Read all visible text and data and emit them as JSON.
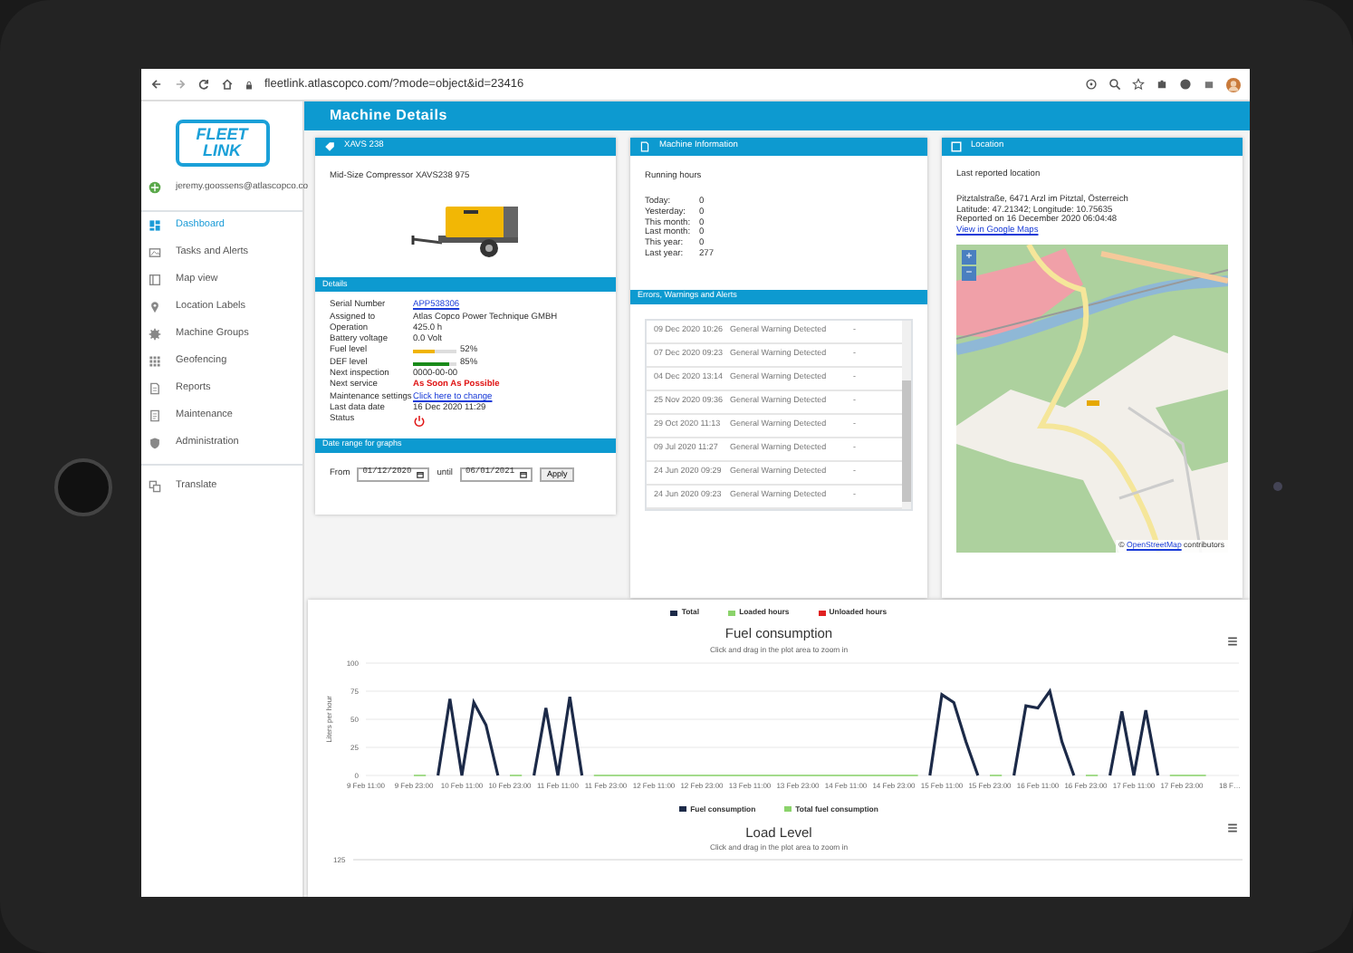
{
  "browser": {
    "url": "fleetlink.atlascopco.com/?mode=object&id=23416"
  },
  "sidebar": {
    "logo": "FLEET LINK",
    "user": "jeremy.goossens@atlascopco.co",
    "items": [
      {
        "label": "Dashboard",
        "selected": true
      },
      {
        "label": "Tasks and Alerts",
        "selected": false
      },
      {
        "label": "Map view",
        "selected": false
      },
      {
        "label": "Location Labels",
        "selected": false
      },
      {
        "label": "Machine Groups",
        "selected": false
      },
      {
        "label": "Geofencing",
        "selected": false
      },
      {
        "label": "Reports",
        "selected": false
      },
      {
        "label": "Maintenance",
        "selected": false
      },
      {
        "label": "Administration",
        "selected": false
      },
      {
        "label": "Translate",
        "selected": false
      }
    ]
  },
  "page_title": "Machine Details",
  "machine_card": {
    "title": "XAVS 238",
    "description": "Mid-Size Compressor XAVS238 975",
    "details_title": "Details",
    "details": [
      {
        "label": "Serial Number",
        "value": "APP538306",
        "kind": "link"
      },
      {
        "label": "Assigned to",
        "value": "Atlas Copco Power Technique GMBH",
        "kind": "text"
      },
      {
        "label": "Operation",
        "value": "425.0 h",
        "kind": "text"
      },
      {
        "label": "Battery voltage",
        "value": "0.0 Volt",
        "kind": "text"
      },
      {
        "label": "Fuel level",
        "value": "52%",
        "kind": "meter",
        "level": 0.52,
        "color": "#f0b400"
      },
      {
        "label": "DEF level",
        "value": "85%",
        "kind": "meter",
        "level": 0.85,
        "color": "#1a8a1a"
      },
      {
        "label": "Next inspection",
        "value": "0000-00-00",
        "kind": "text"
      },
      {
        "label": "Next service",
        "value": "As Soon As Possible",
        "kind": "alert"
      },
      {
        "label": "Maintenance settings",
        "value": "Click here to change",
        "kind": "link"
      },
      {
        "label": "Last data date",
        "value": "16 Dec 2020 11:29",
        "kind": "text"
      },
      {
        "label": "Status",
        "kind": "status"
      }
    ],
    "range_title": "Date range for graphs",
    "from_label": "From",
    "from_value": "01/12/2020",
    "until_label": "until",
    "until_value": "06/01/2021",
    "apply": "Apply"
  },
  "info_card": {
    "title": "Machine Information",
    "running_title": "Running hours",
    "running": [
      {
        "label": "Today:",
        "value": "0"
      },
      {
        "label": "Yesterday:",
        "value": "0"
      },
      {
        "label": "This month:",
        "value": "0"
      },
      {
        "label": "Last month:",
        "value": "0"
      },
      {
        "label": "This year:",
        "value": "0"
      },
      {
        "label": "Last year:",
        "value": "277"
      }
    ],
    "errors_title": "Errors, Warnings and Alerts",
    "errors": [
      {
        "date": "09 Dec 2020 10:26",
        "message": "General Warning Detected",
        "extra": "-"
      },
      {
        "date": "07 Dec 2020 09:23",
        "message": "General Warning Detected",
        "extra": "-"
      },
      {
        "date": "04 Dec 2020 13:14",
        "message": "General Warning Detected",
        "extra": "-"
      },
      {
        "date": "25 Nov 2020 09:36",
        "message": "General Warning Detected",
        "extra": "-"
      },
      {
        "date": "29 Oct 2020 11:13",
        "message": "General Warning Detected",
        "extra": "-"
      },
      {
        "date": "09 Jul 2020 11:27",
        "message": "General Warning Detected",
        "extra": "-"
      },
      {
        "date": "24 Jun 2020 09:29",
        "message": "General Warning Detected",
        "extra": "-"
      },
      {
        "date": "24 Jun 2020 09:23",
        "message": "General Warning Detected",
        "extra": "-"
      }
    ]
  },
  "location_card": {
    "title": "Location",
    "heading": "Last reported location",
    "address": "Pitztalstraße, 6471 Arzl im Pitztal, Österreich",
    "coordinates": "Latitude: 47.21342; Longitude: 10.75635",
    "reported": "Reported on 16 December 2020 06:04:48",
    "maps_link": "View in Google Maps",
    "zoom_in": "+",
    "zoom_out": "−",
    "attribution_prefix": "©",
    "attribution_link": "OpenStreetMap",
    "attribution_suffix": "contributors"
  },
  "fuel_chart": {
    "extra_legend": [
      {
        "name": "Unloaded hours",
        "color": "#e02020"
      }
    ],
    "subtitle": "Click and drag in the plot area to zoom in",
    "chart_data": {
      "type": "line",
      "grid": true,
      "title": "Fuel consumption",
      "ylabel": "Liters per hour",
      "ylim": [
        0,
        100
      ],
      "yticks": [
        0,
        25,
        50,
        75,
        100
      ],
      "categories": [
        "9 Feb 11:00",
        null,
        null,
        null,
        "9 Feb 23:00",
        null,
        null,
        null,
        "10 Feb 11:00",
        null,
        null,
        null,
        "10 Feb 23:00",
        null,
        null,
        null,
        "11 Feb 11:00",
        null,
        null,
        null,
        "11 Feb 23:00",
        null,
        null,
        null,
        "12 Feb 11:00",
        null,
        null,
        null,
        "12 Feb 23:00",
        null,
        null,
        null,
        "13 Feb 11:00",
        null,
        null,
        null,
        "13 Feb 23:00",
        null,
        null,
        null,
        "14 Feb 11:00",
        null,
        null,
        null,
        "14 Feb 23:00",
        null,
        null,
        null,
        "15 Feb 11:00",
        null,
        null,
        null,
        "15 Feb 23:00",
        null,
        null,
        null,
        "16 Feb 11:00",
        null,
        null,
        null,
        "16 Feb 23:00",
        null,
        null,
        null,
        "17 Feb 11:00",
        null,
        null,
        null,
        "17 Feb 23:00",
        null,
        null,
        null,
        "18 F…"
      ],
      "series": [
        {
          "name": "Total",
          "color": "#1c2a48",
          "values": [
            null,
            null,
            null,
            null,
            null,
            null,
            0,
            68,
            0,
            65,
            45,
            0,
            null,
            null,
            0,
            60,
            0,
            70,
            0,
            null,
            null,
            null,
            null,
            null,
            null,
            null,
            null,
            null,
            null,
            null,
            null,
            null,
            null,
            null,
            null,
            null,
            null,
            null,
            null,
            null,
            null,
            null,
            null,
            null,
            null,
            null,
            null,
            0,
            72,
            65,
            30,
            0,
            null,
            null,
            0,
            62,
            60,
            75,
            30,
            0,
            null,
            null,
            0,
            57,
            0,
            58,
            0,
            null,
            null,
            null,
            null,
            null,
            null
          ]
        },
        {
          "name": "Loaded hours",
          "color": "#8bd36b",
          "values": [
            null,
            null,
            null,
            null,
            0,
            0,
            null,
            null,
            null,
            null,
            null,
            null,
            0,
            0,
            null,
            null,
            null,
            null,
            null,
            0,
            0,
            0,
            0,
            0,
            0,
            0,
            0,
            0,
            0,
            0,
            0,
            0,
            0,
            0,
            0,
            0,
            0,
            0,
            0,
            0,
            0,
            0,
            0,
            0,
            0,
            0,
            0,
            null,
            null,
            null,
            null,
            null,
            0,
            0,
            null,
            null,
            null,
            null,
            null,
            null,
            0,
            0,
            null,
            null,
            null,
            null,
            null,
            0,
            0,
            0,
            0,
            null,
            null
          ]
        }
      ]
    }
  },
  "load_chart": {
    "legend": [
      {
        "name": "Fuel consumption",
        "color": "#1c2a48"
      },
      {
        "name": "Total fuel consumption",
        "color": "#8bd36b"
      }
    ],
    "title": "Load Level",
    "subtitle": "Click and drag in the plot area to zoom in",
    "top_tick": "125"
  }
}
